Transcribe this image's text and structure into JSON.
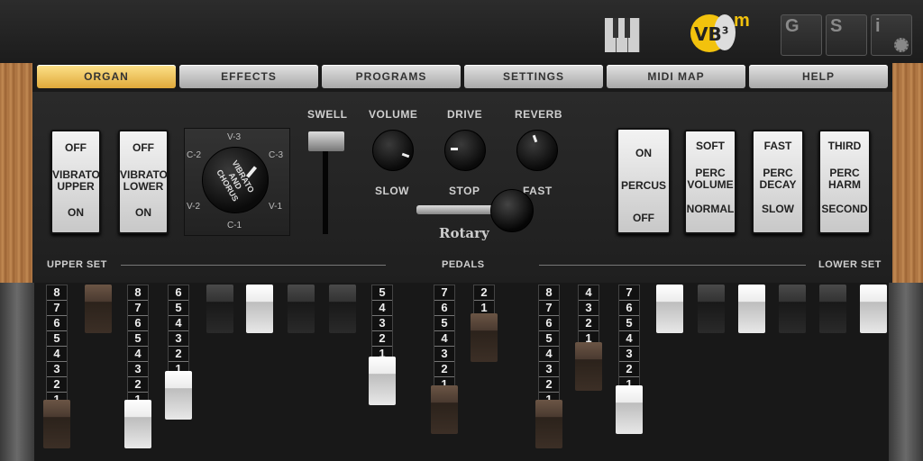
{
  "topbar": {
    "logo_text": "VB",
    "logo_sup": "3",
    "logo_m": "m",
    "buttons": [
      {
        "label": "G",
        "icon": "g-icon"
      },
      {
        "label": "S",
        "icon": "s-icon"
      },
      {
        "label": "i",
        "icon": "info-gear-icon"
      }
    ]
  },
  "tabs": [
    "ORGAN",
    "EFFECTS",
    "PROGRAMS",
    "SETTINGS",
    "MIDI MAP",
    "HELP"
  ],
  "active_tab": "ORGAN",
  "switches": {
    "vibrato_upper": {
      "top": "OFF",
      "label": "VIBRATO UPPER",
      "bottom": "ON"
    },
    "vibrato_lower": {
      "top": "OFF",
      "label": "VIBRATO LOWER",
      "bottom": "ON"
    },
    "percus": {
      "top": "ON",
      "label": "PERCUS",
      "bottom": "OFF"
    },
    "perc_volume": {
      "top": "SOFT",
      "label": "PERC VOLUME",
      "bottom": "NORMAL"
    },
    "perc_decay": {
      "top": "FAST",
      "label": "PERC DECAY",
      "bottom": "SLOW"
    },
    "perc_harm": {
      "top": "THIRD",
      "label": "PERC HARM",
      "bottom": "SECOND"
    }
  },
  "vibrato_selector": {
    "label": "VIBRATO AND CHORUS",
    "positions": [
      "V-3",
      "C-3",
      "V-1",
      "C-1",
      "V-2",
      "C-2"
    ]
  },
  "labels": {
    "swell": "SWELL",
    "volume": "VOLUME",
    "drive": "DRIVE",
    "reverb": "REVERB",
    "slow": "SLOW",
    "stop": "STOP",
    "fast": "FAST",
    "rotary": "Rotary",
    "upper_set": "UPPER SET",
    "pedals": "PEDALS",
    "lower_set": "LOWER SET"
  },
  "drawbar_numbers": [
    "8",
    "7",
    "6",
    "5",
    "4",
    "3",
    "2",
    "1"
  ],
  "drawbars": [
    {
      "color": "brown",
      "value": 8
    },
    {
      "color": "brown",
      "value": 0
    },
    {
      "color": "white",
      "value": 8
    },
    {
      "color": "white",
      "value": 6
    },
    {
      "color": "black",
      "value": 0
    },
    {
      "color": "white",
      "value": 0
    },
    {
      "color": "black",
      "value": 0
    },
    {
      "color": "black",
      "value": 0
    },
    {
      "color": "white",
      "value": 5
    },
    {
      "color": "brown",
      "value": 7
    },
    {
      "color": "brown",
      "value": 2
    },
    {
      "color": "brown",
      "value": 8
    },
    {
      "color": "brown",
      "value": 4
    },
    {
      "color": "white",
      "value": 7
    },
    {
      "color": "white",
      "value": 0
    },
    {
      "color": "black",
      "value": 0
    },
    {
      "color": "white",
      "value": 0
    },
    {
      "color": "black",
      "value": 0
    },
    {
      "color": "black",
      "value": 0
    },
    {
      "color": "white",
      "value": 0
    }
  ],
  "colors": {
    "accent": "#f2c20d",
    "active_tab": "#f0c45a"
  }
}
